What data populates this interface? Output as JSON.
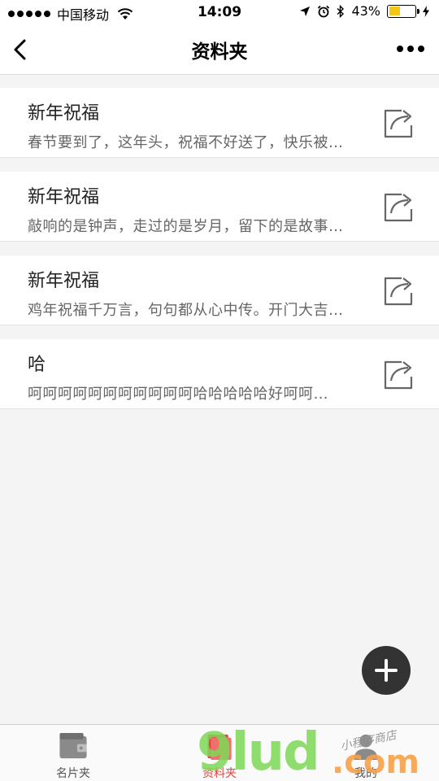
{
  "status_bar": {
    "carrier": "中国移动",
    "time": "14:09",
    "battery": "43%",
    "battery_level": 0.43
  },
  "nav": {
    "title": "资料夹",
    "back_icon": "chevron-left-icon",
    "more_icon": "more-dots-icon"
  },
  "items": [
    {
      "title": "新年祝福",
      "desc": "春节要到了，这年头，祝福不好送了，快乐被…"
    },
    {
      "title": "新年祝福",
      "desc": "敲响的是钟声，走过的是岁月，留下的是故事…"
    },
    {
      "title": "新年祝福",
      "desc": "鸡年祝福千万言，句句都从心中传。开门大吉…"
    },
    {
      "title": "哈",
      "desc": "呵呵呵呵呵呵呵呵呵呵呵哈哈哈哈哈好呵呵…"
    }
  ],
  "fab": {
    "icon": "plus-icon"
  },
  "tabs": [
    {
      "label": "名片夹",
      "icon": "wallet-icon"
    },
    {
      "label": "资料夹",
      "icon": "folder-icon",
      "active": true
    },
    {
      "label": "我的",
      "icon": "person-icon"
    }
  ],
  "watermark": {
    "big": "9lud",
    "com": ".com",
    "small": "小程序商店"
  },
  "colors": {
    "accent": "#e64340",
    "fab": "#333333",
    "battery": "#f5c518"
  }
}
